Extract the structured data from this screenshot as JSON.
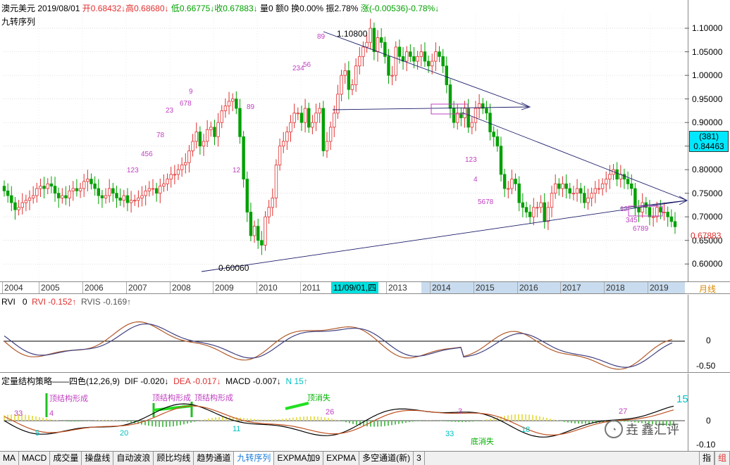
{
  "header": {
    "symbol": "澳元美元",
    "date": "2019/08/01",
    "open": "开0.68432↓",
    "high": "高0.68680↓",
    "low": "低0.66775↓",
    "close": "收0.67883↓",
    "volume": "量0",
    "amount": "额0",
    "turnover": "换0.00%",
    "amplitude": "振2.78%",
    "change": "涨(-0.00536)-0.78%↓",
    "indicator_name": "九转序列"
  },
  "colors": {
    "up": "#e03030",
    "down": "#00a000",
    "ma": "#000000",
    "accent": "#00e0ff",
    "seq": "#c040c0"
  },
  "price_axis": {
    "labels": [
      "1.10000",
      "1.05000",
      "1.00000",
      "0.95000",
      "0.90000",
      "0.85000",
      "0.80000",
      "0.75000",
      "0.70000",
      "0.65000",
      "0.60000"
    ],
    "min": 0.575,
    "max": 1.13,
    "current_count": "(381)",
    "current_value": "0.84463",
    "last_price": "0.67883"
  },
  "annotations": {
    "high_label": "1.10800",
    "low_label": "0.60060"
  },
  "time_axis": {
    "years": [
      "2004",
      "2005",
      "2006",
      "2007",
      "2008",
      "2009",
      "2010",
      "2011",
      "2013",
      "2014",
      "2015",
      "2016",
      "2017",
      "2018",
      "2019"
    ],
    "highlight": "11/09/01,四",
    "period": "月线"
  },
  "rvi_panel": {
    "name": "RVI",
    "param": "0",
    "rvi": "RVI -0.152↑",
    "rvis": "RVIS -0.169↑",
    "scale": [
      "0",
      "-0.50"
    ]
  },
  "macd_panel": {
    "name": "定量结构策略——四色(12,26,9)",
    "dif": "DIF -0.020↓",
    "dea": "DEA -0.017↓",
    "macd": "MACD -0.007↓",
    "n": "N 15↑",
    "scale": [
      "0",
      "-0.10"
    ],
    "n_big": "15",
    "labels": [
      "顶结构形成",
      "顶结构形成",
      "顶结构形成",
      "顶消失",
      "底消失"
    ],
    "numbers": [
      "33",
      "4",
      "5",
      "20",
      "11",
      "26",
      "3",
      "33",
      "18",
      "27"
    ]
  },
  "watermark": {
    "text": "鑫汇评",
    "prefix": "垚"
  },
  "tabs": [
    "MA",
    "MACD",
    "成交量",
    "操盘线",
    "自动波浪",
    "顾比均线",
    "趋势通道",
    "九转序列",
    "EXPMA加9",
    "EXPMA",
    "多空通道(新)",
    "3"
  ],
  "active_tab": "九转序列",
  "right_tabs": [
    "指",
    "组"
  ],
  "chart_data": {
    "type": "candlestick",
    "title": "澳元美元",
    "period": "monthly",
    "y_range": [
      0.575,
      1.13
    ],
    "x_range": [
      "2003-11",
      "2019-08"
    ],
    "key_points": [
      {
        "date": "2008-10",
        "value": 0.6006,
        "label": "0.60060"
      },
      {
        "date": "2011-07",
        "value": 1.108,
        "label": "1.10800"
      }
    ],
    "closes": [
      0.755,
      0.745,
      0.73,
      0.715,
      0.72,
      0.73,
      0.735,
      0.74,
      0.745,
      0.76,
      0.765,
      0.76,
      0.77,
      0.765,
      0.75,
      0.74,
      0.745,
      0.74,
      0.755,
      0.76,
      0.755,
      0.76,
      0.775,
      0.78,
      0.77,
      0.76,
      0.745,
      0.74,
      0.745,
      0.76,
      0.75,
      0.74,
      0.735,
      0.745,
      0.73,
      0.735,
      0.735,
      0.74,
      0.745,
      0.755,
      0.76,
      0.76,
      0.75,
      0.765,
      0.77,
      0.78,
      0.79,
      0.79,
      0.8,
      0.81,
      0.815,
      0.84,
      0.86,
      0.88,
      0.85,
      0.86,
      0.885,
      0.89,
      0.87,
      0.9,
      0.925,
      0.935,
      0.945,
      0.95,
      0.93,
      0.87,
      0.78,
      0.71,
      0.66,
      0.68,
      0.65,
      0.64,
      0.7,
      0.72,
      0.74,
      0.81,
      0.85,
      0.86,
      0.88,
      0.9,
      0.92,
      0.92,
      0.9,
      0.93,
      0.89,
      0.9,
      0.92,
      0.93,
      0.84,
      0.86,
      0.89,
      0.92,
      0.96,
      1.0,
      1.01,
      0.97,
      0.98,
      1.02,
      1.04,
      1.06,
      1.07,
      1.1,
      1.05,
      1.08,
      1.07,
      1.04,
      1.0,
      1.0,
      1.06,
      1.04,
      1.03,
      1.05,
      1.04,
      1.03,
      1.04,
      1.05,
      1.03,
      1.02,
      1.03,
      1.05,
      1.04,
      1.02,
      0.98,
      0.93,
      0.9,
      0.92,
      0.91,
      0.93,
      0.89,
      0.9,
      0.93,
      0.94,
      0.93,
      0.92,
      0.88,
      0.87,
      0.85,
      0.79,
      0.76,
      0.76,
      0.78,
      0.77,
      0.73,
      0.72,
      0.71,
      0.7,
      0.72,
      0.72,
      0.73,
      0.69,
      0.72,
      0.75,
      0.77,
      0.76,
      0.77,
      0.76,
      0.75,
      0.75,
      0.76,
      0.75,
      0.73,
      0.74,
      0.75,
      0.76,
      0.76,
      0.77,
      0.78,
      0.79,
      0.8,
      0.78,
      0.79,
      0.78,
      0.77,
      0.76,
      0.72,
      0.71,
      0.73,
      0.72,
      0.7,
      0.7,
      0.72,
      0.71,
      0.71,
      0.7,
      0.69,
      0.679
    ]
  }
}
